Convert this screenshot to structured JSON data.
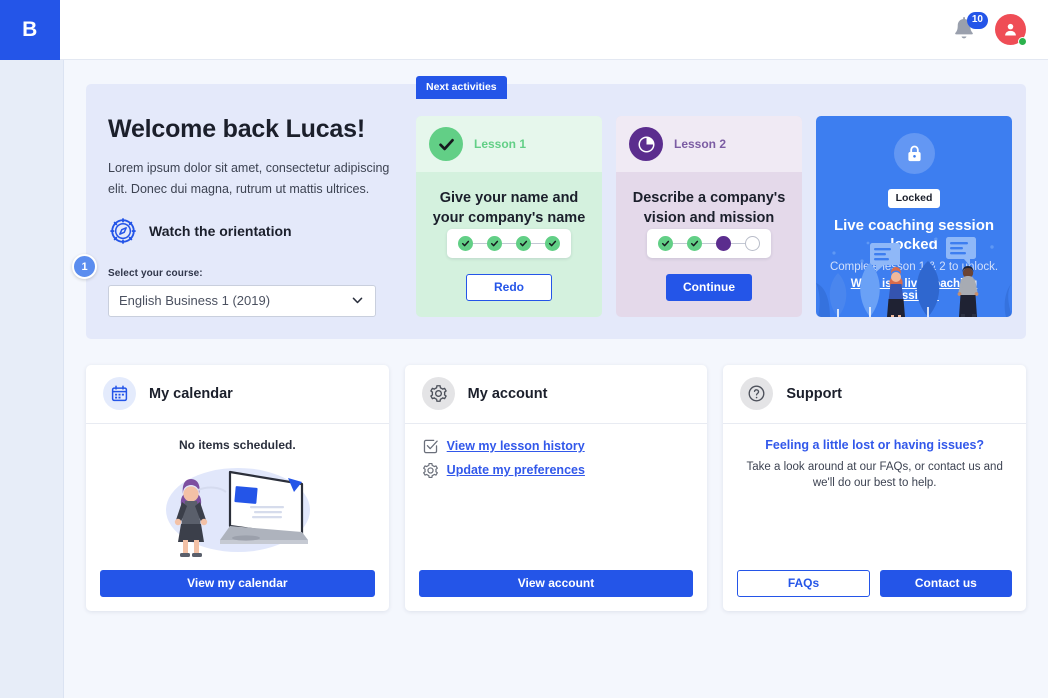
{
  "topbar": {
    "logo": "B",
    "logo_icon": "brand-logo",
    "bell_icon": "bell-icon",
    "notification_count": "10",
    "avatar_icon": "user-avatar-icon",
    "status_icon": "online-status-dot"
  },
  "hero": {
    "title": "Welcome back Lucas!",
    "body": "Lorem ipsum dolor sit amet, consectetur adipiscing elit. Donec dui magna, rutrum ut mattis ultrices.",
    "step_badge": "1",
    "orientation_icon": "compass-icon",
    "orientation_label": "Watch the orientation",
    "course_field_label": "Select your course:",
    "course_value": "English Business 1 (2019)",
    "course_caret_icon": "chevron-down-icon"
  },
  "next_activities": {
    "tab_label": "Next activities",
    "lessons": [
      {
        "tag": "Lesson 1",
        "status_icon": "check-circle-icon",
        "name": "Give your name and your company's name",
        "progress": [
          "done",
          "done",
          "done",
          "done"
        ],
        "button": "Redo",
        "button_style": "outline"
      },
      {
        "tag": "Lesson 2",
        "status_icon": "pie-progress-icon",
        "name": "Describe a company's vision and mission",
        "progress": [
          "done",
          "done",
          "current",
          "empty"
        ],
        "button": "Continue",
        "button_style": "solid"
      }
    ],
    "coaching": {
      "lock_icon": "lock-icon",
      "chip": "Locked",
      "title": "Live coaching session locked",
      "subtitle": "Complete lesson 1 & 2 to unlock.",
      "link": "What is a live coaching session?",
      "illustration": "people-talking-illustration"
    }
  },
  "cards": {
    "calendar": {
      "icon": "calendar-icon",
      "title": "My calendar",
      "empty_text": "No items scheduled.",
      "illustration": "woman-with-laptop-illustration",
      "button": "View my calendar"
    },
    "account": {
      "icon": "gear-icon",
      "title": "My account",
      "links": [
        {
          "icon": "checkbox-icon",
          "label": "View my lesson history"
        },
        {
          "icon": "gear-icon",
          "label": "Update my preferences"
        }
      ],
      "button": "View account"
    },
    "support": {
      "icon": "question-circle-icon",
      "title": "Support",
      "headline": "Feeling a little lost or having issues?",
      "text": "Take a look around at our FAQs, or contact us and we'll do our best to help.",
      "buttons": [
        {
          "label": "FAQs",
          "style": "ghost"
        },
        {
          "label": "Contact us",
          "style": "primary"
        }
      ]
    }
  },
  "colors": {
    "brand_blue": "#2455e8",
    "coach_blue": "#3d7ef0",
    "hero_bg": "#e4e9fa",
    "green": "#62cf86",
    "purple": "#5b2d8e",
    "avatar_red": "#ef4d56",
    "status_green": "#2bb24c"
  }
}
